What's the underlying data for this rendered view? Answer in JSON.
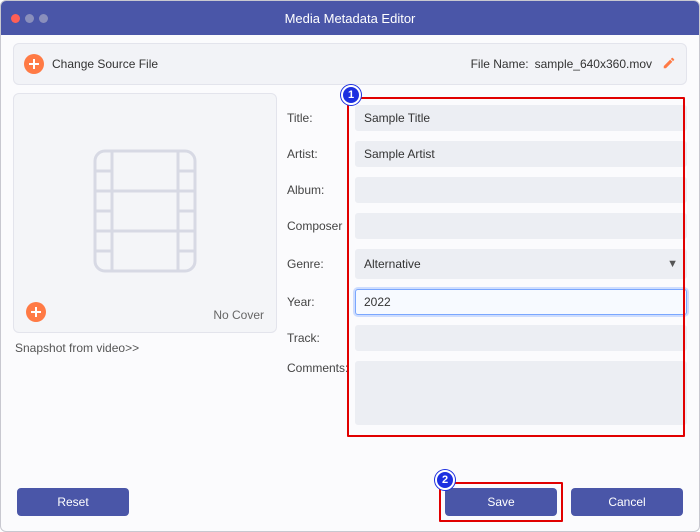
{
  "window": {
    "title": "Media Metadata Editor"
  },
  "toolbar": {
    "change_source": "Change Source File",
    "file_name_label": "File Name:",
    "file_name_value": "sample_640x360.mov"
  },
  "cover": {
    "no_cover": "No Cover",
    "snapshot_link": "Snapshot from video>>"
  },
  "labels": {
    "title": "Title:",
    "artist": "Artist:",
    "album": "Album:",
    "composer": "Composer",
    "genre": "Genre:",
    "year": "Year:",
    "track": "Track:",
    "comments": "Comments:"
  },
  "fields": {
    "title": "Sample Title",
    "artist": "Sample Artist",
    "album": "",
    "composer": "",
    "genre": "Alternative",
    "year": "2022",
    "track": "",
    "comments": ""
  },
  "buttons": {
    "reset": "Reset",
    "save": "Save",
    "cancel": "Cancel"
  },
  "annotations": {
    "step1": "1",
    "step2": "2"
  }
}
